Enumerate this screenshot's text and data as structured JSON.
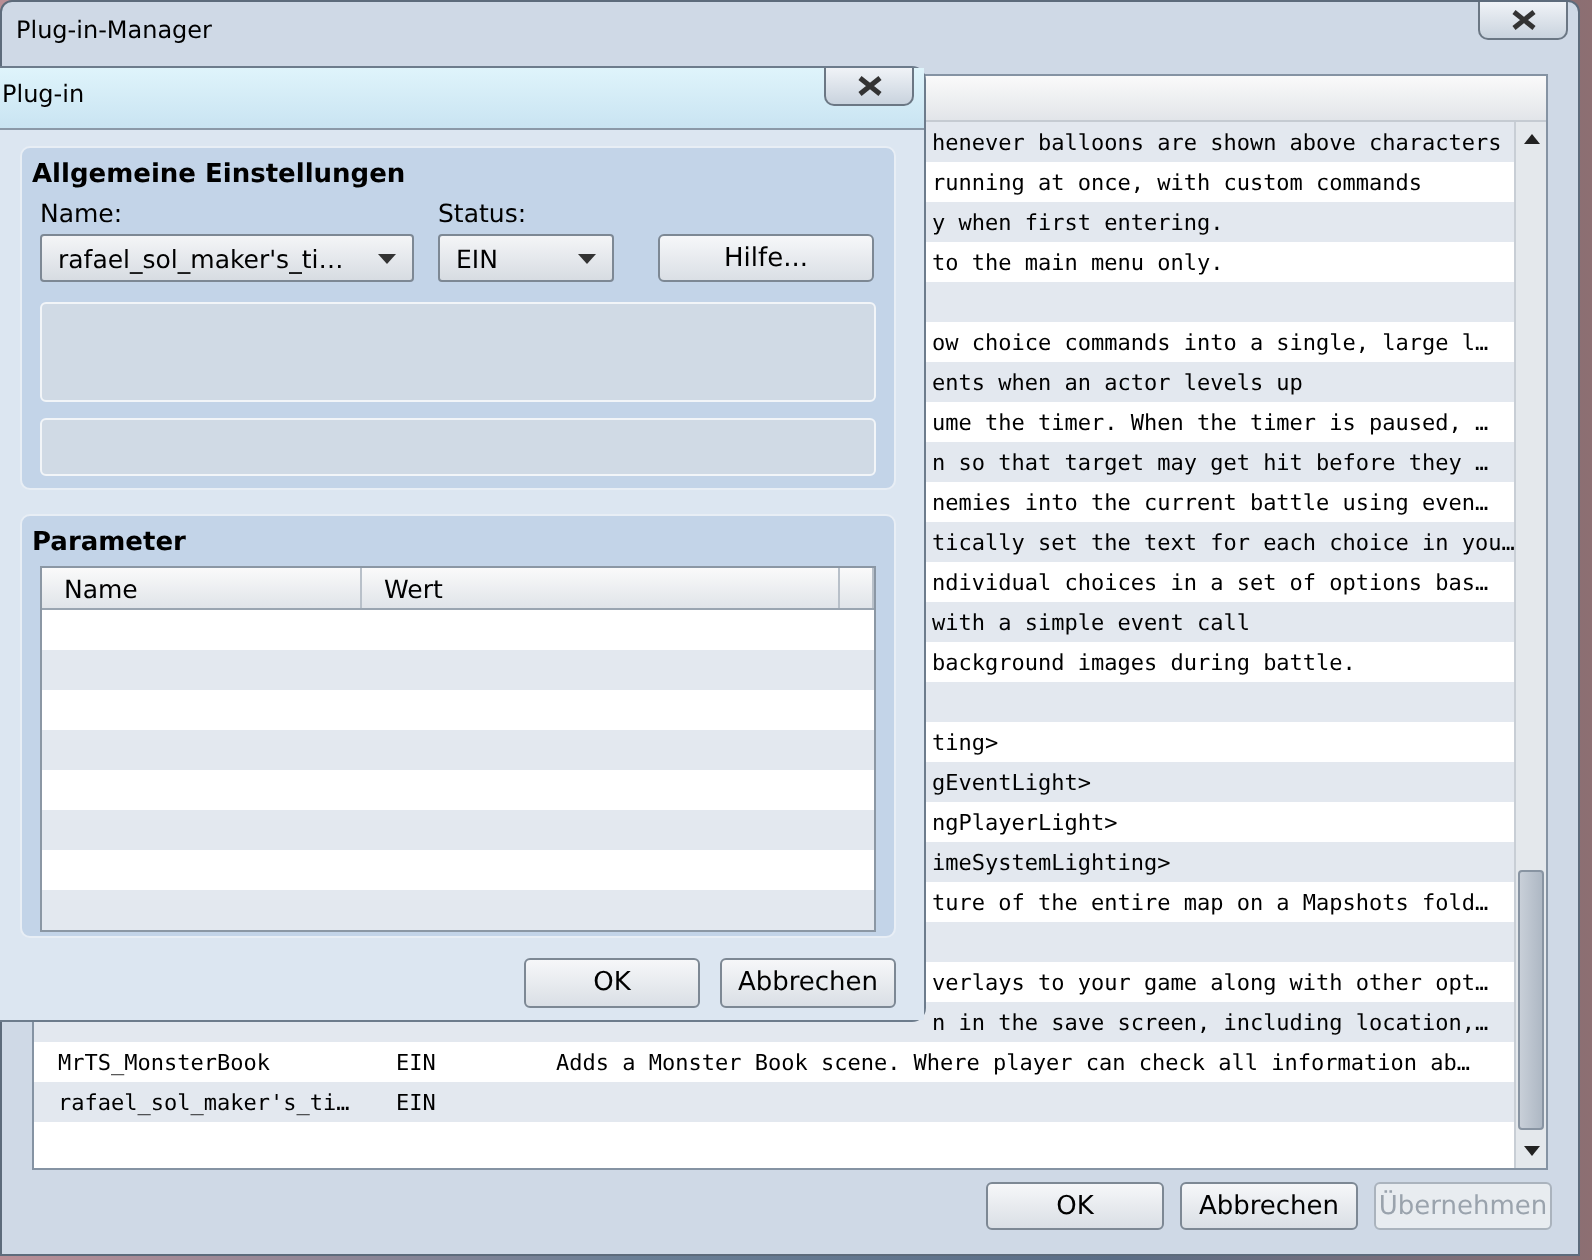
{
  "window": {
    "title": "Plug-in-Manager"
  },
  "list": {
    "rows": [
      {
        "description": "henever balloons are shown above characters"
      },
      {
        "description": "running at once, with custom commands"
      },
      {
        "description": "y when first entering."
      },
      {
        "description": "to the main menu only."
      },
      {},
      {
        "description": "ow choice commands into a single, large l…"
      },
      {
        "description": "ents when an actor levels up"
      },
      {
        "description": "ume the timer. When the timer is paused, …"
      },
      {
        "description": "n so that target may get hit before they …"
      },
      {
        "description": "nemies into the current battle using even…"
      },
      {
        "description": "tically set the text for each choice in you…"
      },
      {
        "description": "ndividual choices in a set of options bas…"
      },
      {
        "description": "with a simple event call"
      },
      {
        "description": "background images during battle."
      },
      {},
      {
        "description": "ting>"
      },
      {
        "description": "gEventLight>"
      },
      {
        "description": "ngPlayerLight>"
      },
      {
        "description": "imeSystemLighting>"
      },
      {
        "description": "ture of the entire map on a Mapshots fold…"
      },
      {},
      {
        "description": "verlays to your game along with other opt…"
      },
      {
        "description": "n in the save screen, including location,…"
      },
      {
        "name": "MrTS_MonsterBook",
        "status": "EIN",
        "description": "Adds a Monster Book scene. Where player can check all information ab…"
      },
      {
        "name": "rafael_sol_maker's_ti…",
        "status": "EIN"
      }
    ]
  },
  "buttons": [
    {
      "label": "OK",
      "disabled": false
    },
    {
      "label": "Abbrechen",
      "disabled": false
    },
    {
      "label": "Übernehmen",
      "disabled": true
    }
  ],
  "dialog": {
    "title": "Plug-in",
    "general": {
      "heading": "Allgemeine Einstellungen",
      "name_label": "Name:",
      "name_value": "rafael_sol_maker's_ti…",
      "status_label": "Status:",
      "status_value": "EIN",
      "help_button": "Hilfe..."
    },
    "parameters": {
      "heading": "Parameter",
      "columns": [
        "Name",
        "Wert"
      ]
    },
    "buttons": [
      "OK",
      "Abbrechen"
    ]
  }
}
